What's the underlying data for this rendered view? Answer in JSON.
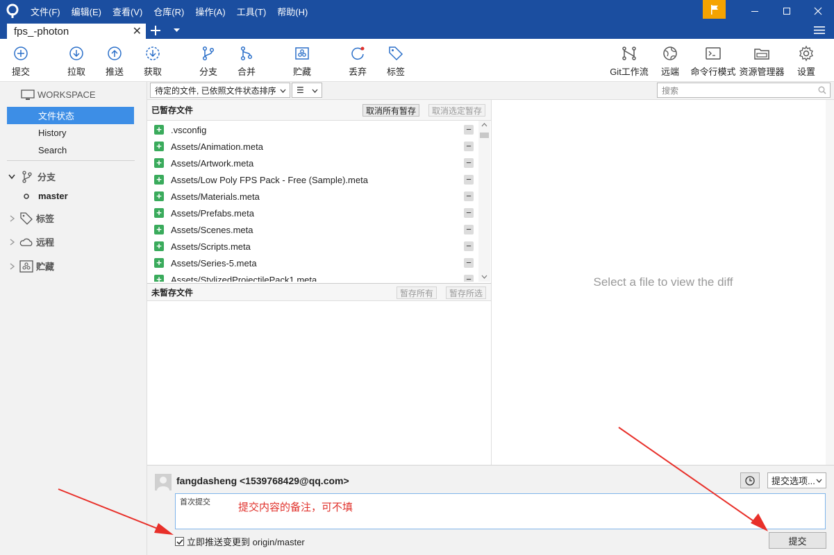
{
  "menu": [
    "文件(F)",
    "编辑(E)",
    "查看(V)",
    "仓库(R)",
    "操作(A)",
    "工具(T)",
    "帮助(H)"
  ],
  "tab": {
    "title": "fps_-photon"
  },
  "toolbar": {
    "commit": "提交",
    "pull": "拉取",
    "push": "推送",
    "fetch": "获取",
    "branch": "分支",
    "merge": "合并",
    "stash": "贮藏",
    "discard": "丢弃",
    "tag": "标签",
    "gitflow": "Git工作流",
    "remote": "远端",
    "terminal": "命令行模式",
    "explorer": "资源管理器",
    "settings": "设置"
  },
  "sidebar": {
    "workspace": "WORKSPACE",
    "items": [
      "文件状态",
      "History",
      "Search"
    ],
    "branches": "分支",
    "current_branch": "master",
    "tags": "标签",
    "remotes": "远程",
    "stashes": "贮藏"
  },
  "filter": {
    "sort": "待定的文件, 已依照文件状态排序",
    "view": "☰",
    "search_placeholder": "搜索"
  },
  "staged": {
    "header": "已暂存文件",
    "unstage_all": "取消所有暂存",
    "unstage_selected": "取消选定暂存",
    "files": [
      ".vsconfig",
      "Assets/Animation.meta",
      "Assets/Artwork.meta",
      "Assets/Low Poly FPS Pack - Free (Sample).meta",
      "Assets/Materials.meta",
      "Assets/Prefabs.meta",
      "Assets/Scenes.meta",
      "Assets/Scripts.meta",
      "Assets/Series-5.meta",
      "Assets/StylizedProjectilePack1.meta"
    ]
  },
  "unstaged": {
    "header": "未暂存文件",
    "stage_all": "暂存所有",
    "stage_selected": "暂存所选"
  },
  "diff": {
    "empty": "Select a file to view the diff"
  },
  "commit": {
    "author": "fangdasheng <1539768429@qq.com>",
    "message": "首次提交",
    "annotation": "提交内容的备注，可不填",
    "options": "提交选项...",
    "push_label": "立即推送变更到 origin/master",
    "push_checked": true,
    "submit": "提交"
  },
  "colors": {
    "titlebar": "#1b4ea0",
    "selection": "#3d8ee6",
    "added": "#3aab5c",
    "flag": "#f5a300",
    "annotation": "#e0302a"
  }
}
